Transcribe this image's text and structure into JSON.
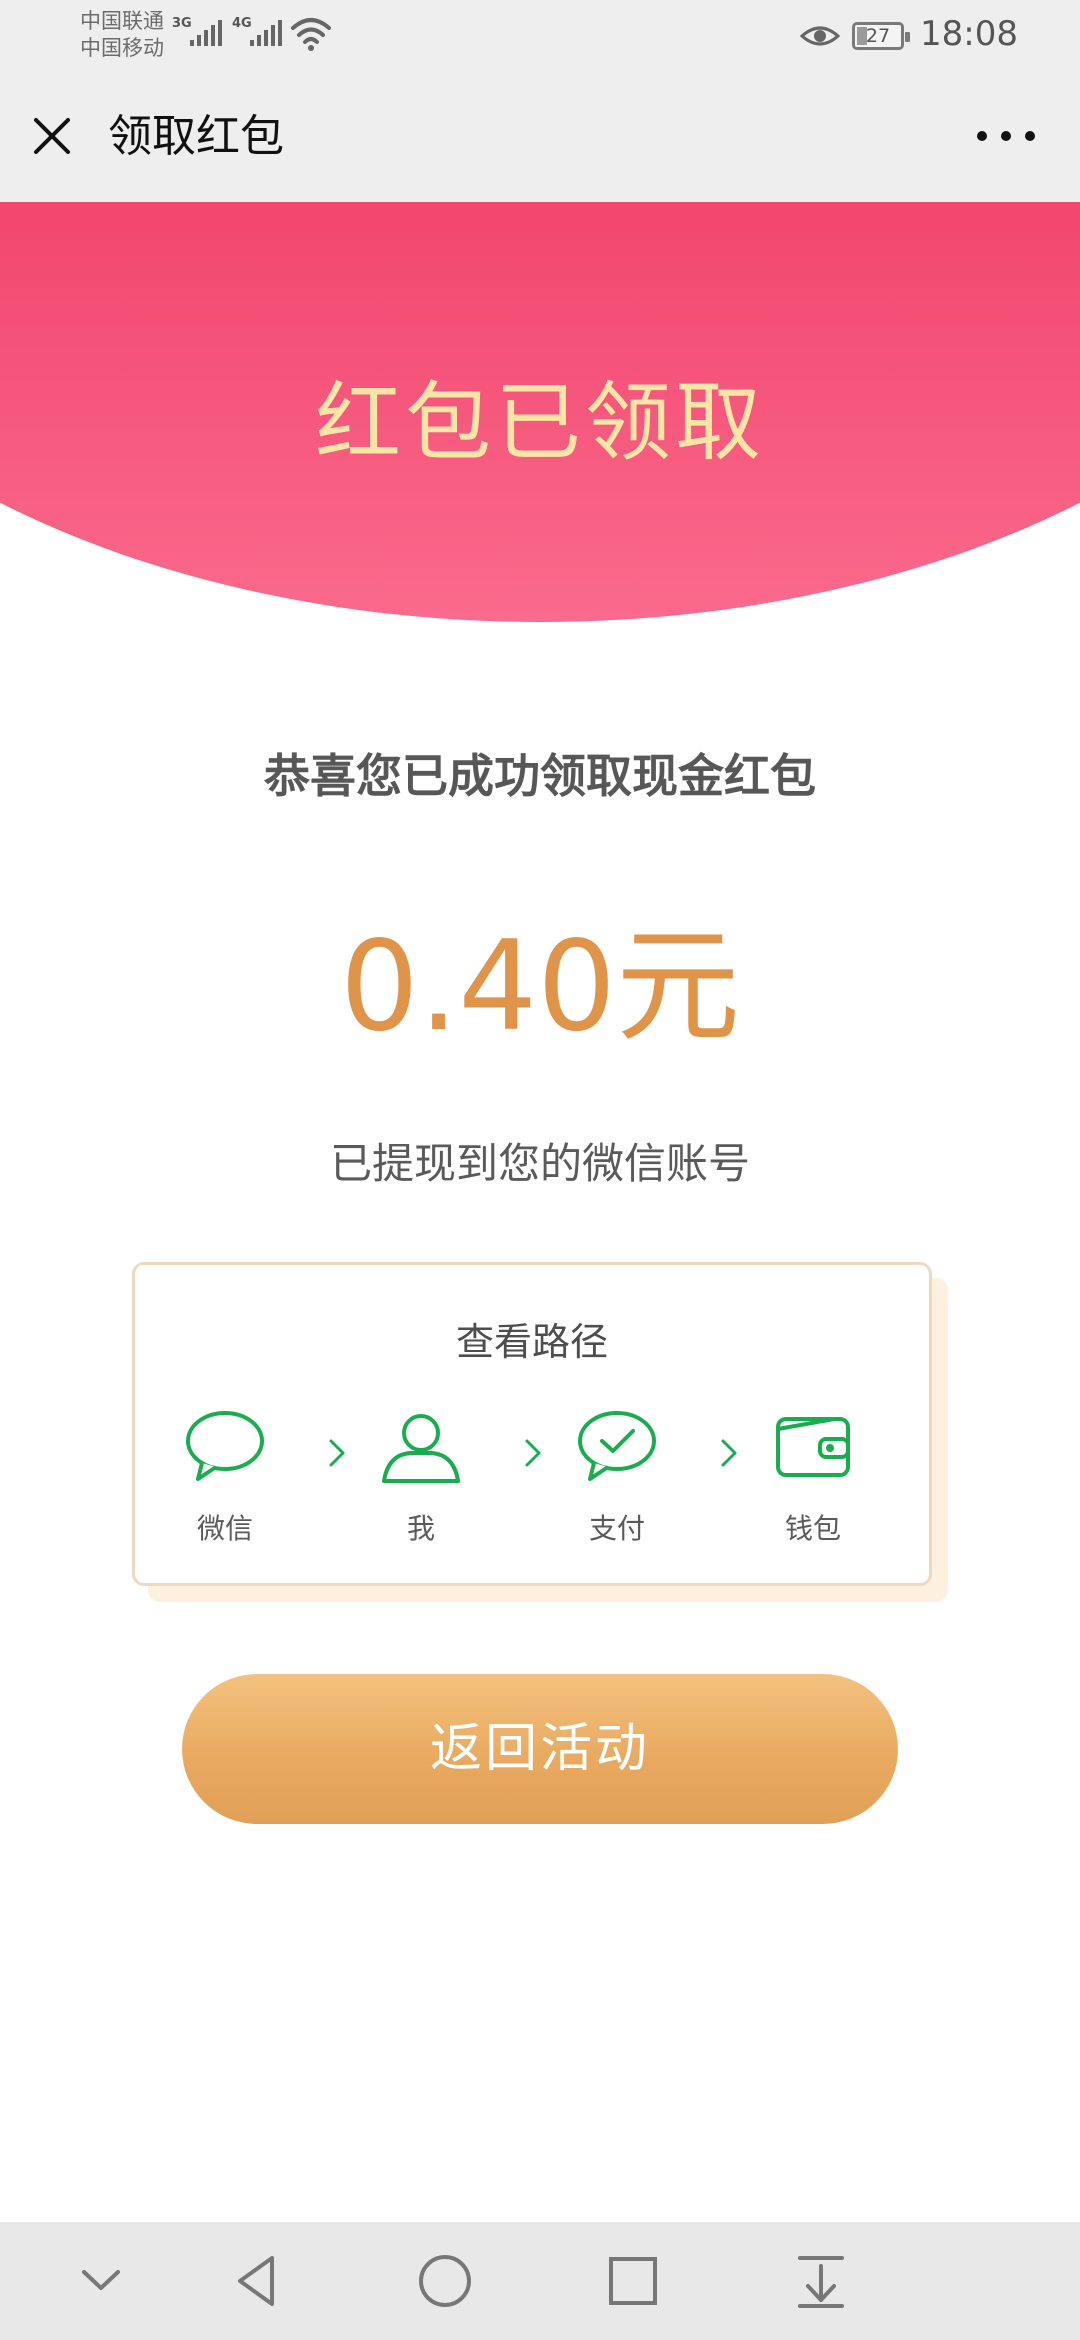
{
  "status_bar": {
    "carrier_1": "中国联通",
    "carrier_2": "中国移动",
    "network_1": "3G",
    "network_2": "4G",
    "battery": "27",
    "time": "18:08",
    "icons": [
      "signal-icon",
      "wifi-icon",
      "eye-icon",
      "battery-icon"
    ]
  },
  "title_bar": {
    "title": "领取红包",
    "close_icon": "close-icon",
    "more_icon": "more-icon"
  },
  "banner": {
    "title": "红包已领取",
    "title_color": "#fae5a7",
    "bg_color": "#f2476f"
  },
  "result": {
    "congrats": "恭喜您已成功领取现金红包",
    "amount": "0.40元",
    "amount_color": "#e0944a",
    "withdrawn_note": "已提现到您的微信账号"
  },
  "path_card": {
    "title": "查看路径",
    "steps": [
      {
        "label": "微信",
        "icon": "chat-bubble-icon"
      },
      {
        "label": "我",
        "icon": "person-icon"
      },
      {
        "label": "支付",
        "icon": "check-bubble-icon"
      },
      {
        "label": "钱包",
        "icon": "wallet-icon"
      }
    ],
    "icon_color": "#1aad50"
  },
  "return_button": {
    "label": "返回活动"
  },
  "nav_bar": {
    "icons": [
      "chevron-down-icon",
      "back-triangle-icon",
      "home-circle-icon",
      "recents-square-icon",
      "download-icon"
    ]
  }
}
